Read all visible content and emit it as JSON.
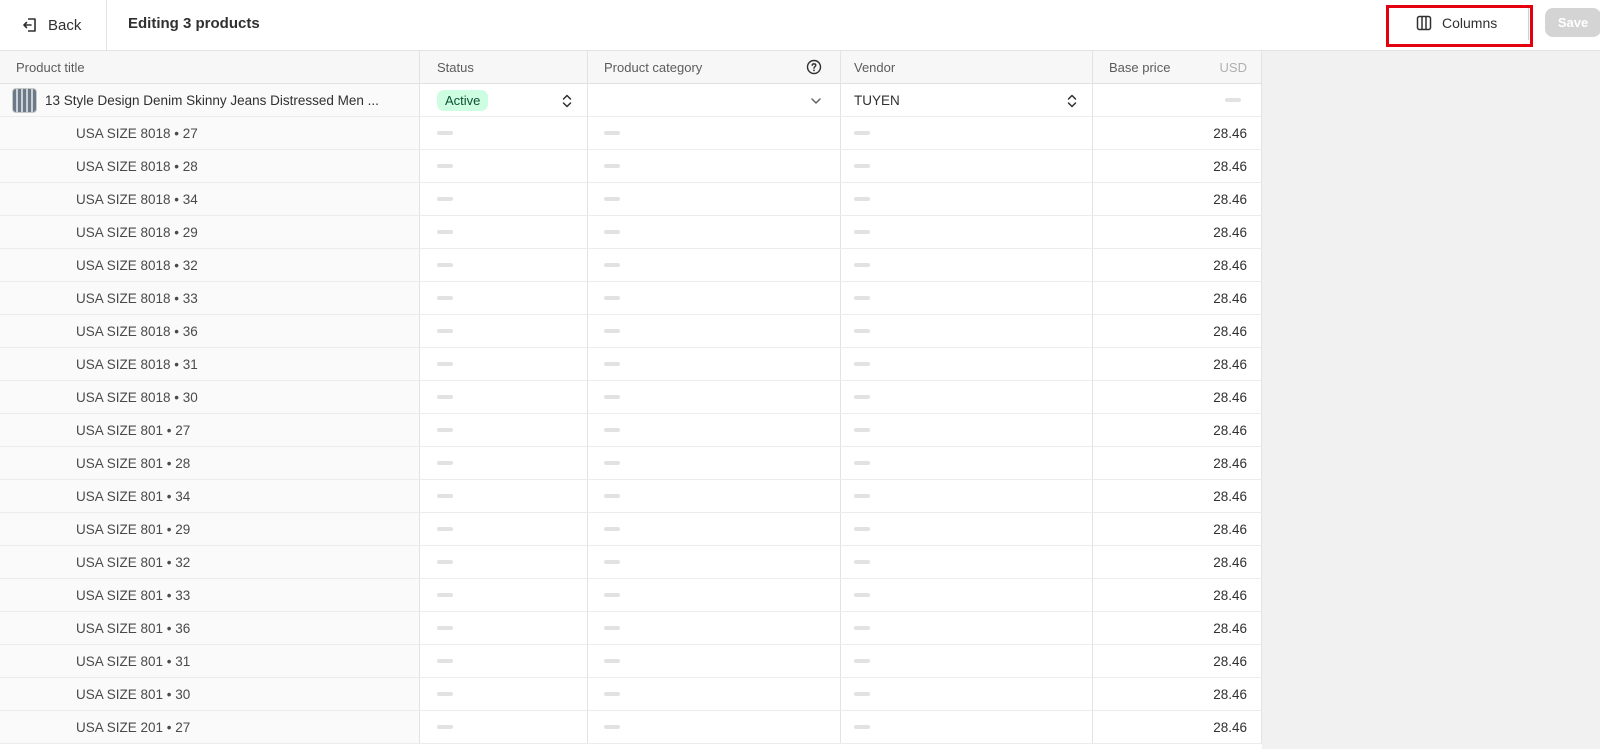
{
  "header": {
    "back_label": "Back",
    "title": "Editing 3 products",
    "columns_label": "Columns",
    "save_label": "Save"
  },
  "table": {
    "columns": {
      "title": "Product title",
      "status": "Status",
      "category": "Product category",
      "vendor": "Vendor",
      "price": "Base price",
      "currency": "USD"
    },
    "product": {
      "title": "13 Style Design Denim Skinny Jeans Distressed Men ...",
      "status": "Active",
      "category": "",
      "vendor": "TUYEN"
    },
    "variants": [
      {
        "title": "USA SIZE 8018 • 27",
        "price": "28.46"
      },
      {
        "title": "USA SIZE 8018 • 28",
        "price": "28.46"
      },
      {
        "title": "USA SIZE 8018 • 34",
        "price": "28.46"
      },
      {
        "title": "USA SIZE 8018 • 29",
        "price": "28.46"
      },
      {
        "title": "USA SIZE 8018 • 32",
        "price": "28.46"
      },
      {
        "title": "USA SIZE 8018 • 33",
        "price": "28.46"
      },
      {
        "title": "USA SIZE 8018 • 36",
        "price": "28.46"
      },
      {
        "title": "USA SIZE 8018 • 31",
        "price": "28.46"
      },
      {
        "title": "USA SIZE 8018 • 30",
        "price": "28.46"
      },
      {
        "title": "USA SIZE 801 • 27",
        "price": "28.46"
      },
      {
        "title": "USA SIZE 801 • 28",
        "price": "28.46"
      },
      {
        "title": "USA SIZE 801 • 34",
        "price": "28.46"
      },
      {
        "title": "USA SIZE 801 • 29",
        "price": "28.46"
      },
      {
        "title": "USA SIZE 801 • 32",
        "price": "28.46"
      },
      {
        "title": "USA SIZE 801 • 33",
        "price": "28.46"
      },
      {
        "title": "USA SIZE 801 • 36",
        "price": "28.46"
      },
      {
        "title": "USA SIZE 801 • 31",
        "price": "28.46"
      },
      {
        "title": "USA SIZE 801 • 30",
        "price": "28.46"
      },
      {
        "title": "USA SIZE 201 • 27",
        "price": "28.46"
      }
    ]
  },
  "colors": {
    "active_badge_bg": "#cdfee1",
    "active_badge_text": "#0c5132",
    "highlight": "#e3000f",
    "save_disabled": "#d4d4d4"
  }
}
